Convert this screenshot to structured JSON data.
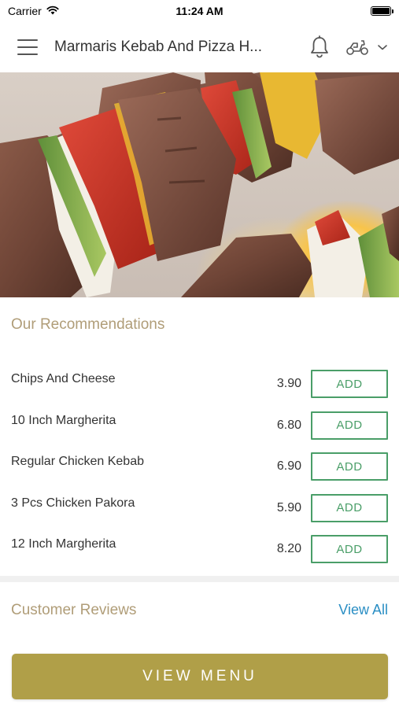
{
  "status_bar": {
    "carrier": "Carrier",
    "time": "11:24 AM",
    "battery_level": 1.0
  },
  "header": {
    "title": "Marmaris Kebab And Pizza H...",
    "menu_icon": "hamburger-menu-icon",
    "notification_icon": "bell-icon",
    "delivery_icon": "scooter-icon",
    "dropdown_icon": "chevron-down-icon"
  },
  "hero": {
    "image": "grilled-kebab-skewers-over-fire"
  },
  "recommendations": {
    "title": "Our Recommendations",
    "items": [
      {
        "name": "Chips And Cheese",
        "price": "3.90",
        "button": "ADD"
      },
      {
        "name": "10 Inch Margherita",
        "price": "6.80",
        "button": "ADD"
      },
      {
        "name": "Regular Chicken Kebab",
        "price": "6.90",
        "button": "ADD"
      },
      {
        "name": "3 Pcs Chicken Pakora",
        "price": "5.90",
        "button": "ADD"
      },
      {
        "name": "12 Inch Margherita",
        "price": "8.20",
        "button": "ADD"
      }
    ]
  },
  "reviews": {
    "title": "Customer Reviews",
    "view_all": "View All"
  },
  "footer": {
    "view_menu": "VIEW MENU"
  },
  "colors": {
    "accent_gold": "#b09f48",
    "section_title": "#b09d78",
    "add_green": "#4a9e68",
    "link_blue": "#2a8ec4"
  }
}
